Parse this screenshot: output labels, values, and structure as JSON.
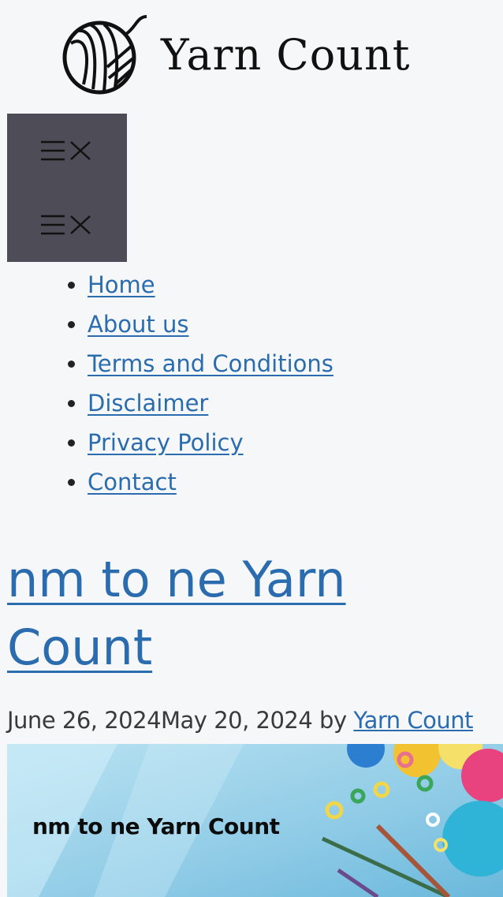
{
  "site": {
    "logo_text": "Yarn Count",
    "logo_icon": "yarn-ball-icon"
  },
  "header": {
    "toggles": [
      {
        "icon": "menu-close-icon"
      },
      {
        "icon": "menu-close-icon"
      }
    ]
  },
  "nav": {
    "items": [
      {
        "label": "Home"
      },
      {
        "label": "About us"
      },
      {
        "label": "Terms and Conditions"
      },
      {
        "label": "Disclaimer"
      },
      {
        "label": "Privacy Policy"
      },
      {
        "label": "Contact"
      }
    ]
  },
  "post": {
    "title": "nm to ne Yarn Count",
    "published": "June 26, 2024",
    "updated": "May 20, 2024",
    "by_label": " by ",
    "author": "Yarn Count",
    "featured_image_text": "nm to ne Yarn Count"
  },
  "colors": {
    "background": "#f6f7f9",
    "link": "#2a6cae",
    "toggle_bg": "#4e4c56",
    "image_sky": "#9fd3ea"
  }
}
